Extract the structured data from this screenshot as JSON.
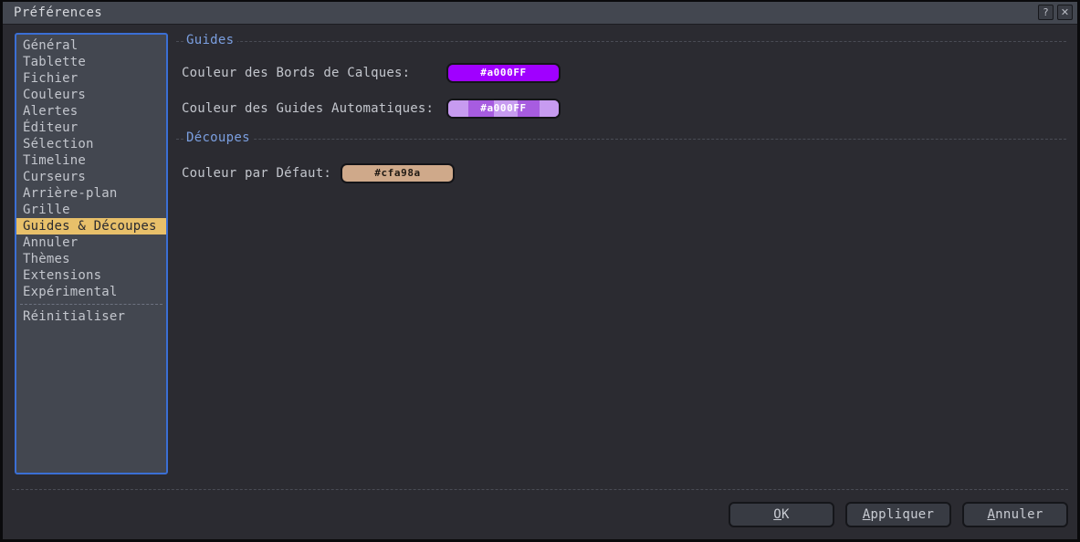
{
  "window": {
    "title": "Préférences",
    "help_button": "?",
    "close_button": "✕"
  },
  "colors": {
    "window_bg": "#2b2b31",
    "titlebar_bg": "#434750",
    "sidebar_bg": "#434750",
    "sidebar_border": "#3b6fd4",
    "selection_bg": "#e8c06a",
    "selection_fg": "#2a2a30",
    "group_title": "#7b9fe0",
    "text": "#c3c6cd",
    "guide_purple": "#a000ff",
    "slice_tan": "#cfa98a"
  },
  "sidebar": {
    "items": [
      {
        "label": "Général",
        "selected": false
      },
      {
        "label": "Tablette",
        "selected": false
      },
      {
        "label": "Fichier",
        "selected": false
      },
      {
        "label": "Couleurs",
        "selected": false
      },
      {
        "label": "Alertes",
        "selected": false
      },
      {
        "label": "Éditeur",
        "selected": false
      },
      {
        "label": "Sélection",
        "selected": false
      },
      {
        "label": "Timeline",
        "selected": false
      },
      {
        "label": "Curseurs",
        "selected": false
      },
      {
        "label": "Arrière-plan",
        "selected": false
      },
      {
        "label": "Grille",
        "selected": false
      },
      {
        "label": "Guides & Découpes",
        "selected": true
      },
      {
        "label": "Annuler",
        "selected": false
      },
      {
        "label": "Thèmes",
        "selected": false
      },
      {
        "label": "Extensions",
        "selected": false
      },
      {
        "label": "Expérimental",
        "selected": false
      }
    ],
    "reset_label": "Réinitialiser"
  },
  "main": {
    "groups": [
      {
        "title": "Guides",
        "fields": [
          {
            "label": "Couleur des Bords de Calques:",
            "value": "#a000FF",
            "swatch_color": "#a000ff",
            "swatch_text_color": "#ffffff",
            "transparent": false
          },
          {
            "label": "Couleur des Guides Automatiques:",
            "value": "#a000FF",
            "swatch_color": "#a855e8",
            "swatch_text_color": "#ffffff",
            "transparent": true
          }
        ]
      },
      {
        "title": "Découpes",
        "fields": [
          {
            "label": "Couleur par Défaut:",
            "value": "#cfa98a",
            "swatch_color": "#cfa98a",
            "swatch_text_color": "#201a14",
            "transparent": false
          }
        ]
      }
    ]
  },
  "footer": {
    "buttons": [
      {
        "mnemonic": "O",
        "rest": "K"
      },
      {
        "mnemonic": "A",
        "rest": "ppliquer"
      },
      {
        "mnemonic": "A",
        "rest": "nnuler"
      }
    ]
  }
}
